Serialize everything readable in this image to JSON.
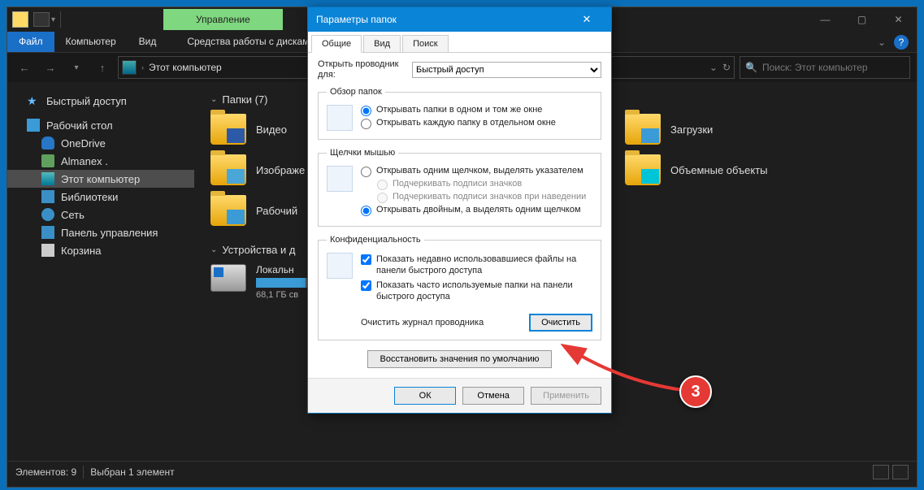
{
  "titlebar": {
    "manage_tab": "Управление"
  },
  "ribbon": {
    "file": "Файл",
    "computer": "Компьютер",
    "view": "Вид",
    "disk_tools": "Средства работы с дисками"
  },
  "navbar": {
    "location": "Этот компьютер",
    "search_placeholder": "Поиск: Этот компьютер"
  },
  "sidebar": {
    "quick_access": "Быстрый доступ",
    "desktop": "Рабочий стол",
    "onedrive": "OneDrive",
    "user": "Almanex .",
    "this_pc": "Этот компьютер",
    "libraries": "Библиотеки",
    "network": "Сеть",
    "control_panel": "Панель управления",
    "recycle_bin": "Корзина"
  },
  "content": {
    "folders_hdr": "Папки (7)",
    "devices_hdr": "Устройства и д",
    "folders": {
      "video": "Видео",
      "images": "Изображе",
      "desktop": "Рабочий",
      "downloads": "Загрузки",
      "objects3d": "Объемные объекты"
    },
    "drive": {
      "name": "Локальн",
      "free": "68,1 ГБ св"
    }
  },
  "statusbar": {
    "items": "Элементов: 9",
    "selected": "Выбран 1 элемент"
  },
  "dialog": {
    "title": "Параметры папок",
    "tabs": {
      "general": "Общие",
      "view": "Вид",
      "search": "Поиск"
    },
    "open_label": "Открыть проводник для:",
    "open_value": "Быстрый доступ",
    "browse": {
      "legend": "Обзор папок",
      "same_window": "Открывать папки в одном и том же окне",
      "new_window": "Открывать каждую папку в отдельном окне"
    },
    "clicks": {
      "legend": "Щелчки мышью",
      "single": "Открывать одним щелчком, выделять указателем",
      "underline_always": "Подчеркивать подписи значков",
      "underline_hover": "Подчеркивать подписи значков при наведении",
      "double": "Открывать двойным, а выделять одним щелчком"
    },
    "privacy": {
      "legend": "Конфиденциальность",
      "recent_files": "Показать недавно использовавшиеся файлы на панели быстрого доступа",
      "frequent_folders": "Показать часто используемые папки на панели быстрого доступа",
      "clear_label": "Очистить журнал проводника",
      "clear_btn": "Очистить"
    },
    "restore_defaults": "Восстановить значения по умолчанию",
    "ok": "ОК",
    "cancel": "Отмена",
    "apply": "Применить"
  },
  "annotation": {
    "badge": "3"
  }
}
